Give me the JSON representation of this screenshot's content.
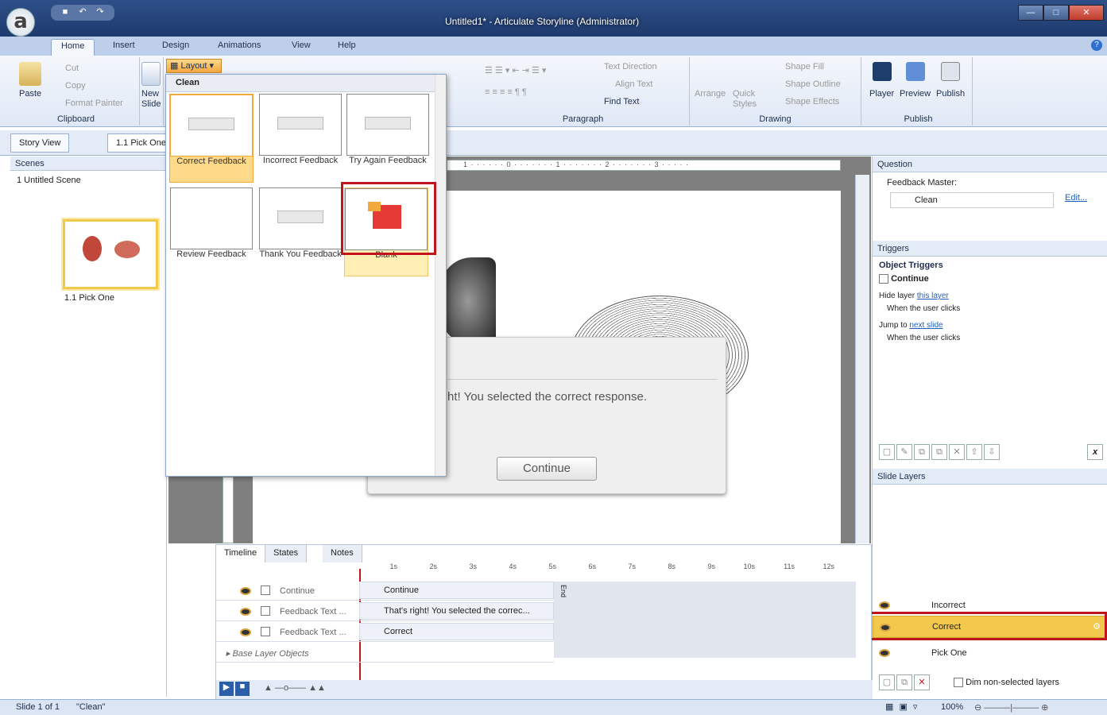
{
  "window": {
    "title": "Untitled1* - Articulate Storyline (Administrator)"
  },
  "menu_tabs": [
    "Home",
    "Insert",
    "Design",
    "Animations",
    "View",
    "Help"
  ],
  "ribbon": {
    "clipboard": {
      "paste": "Paste",
      "cut": "Cut",
      "copy": "Copy",
      "format_painter": "Format Painter",
      "label": "Clipboard"
    },
    "slides": {
      "new_slide": "New Slide",
      "layout": "Layout"
    },
    "paragraph": {
      "text_direction": "Text Direction",
      "align_text": "Align Text",
      "find_text": "Find Text",
      "label": "Paragraph"
    },
    "drawing": {
      "arrange": "Arrange",
      "quick_styles": "Quick Styles",
      "shape_fill": "Shape Fill",
      "shape_outline": "Shape Outline",
      "shape_effects": "Shape Effects",
      "label": "Drawing"
    },
    "publish": {
      "player": "Player",
      "preview": "Preview",
      "publish": "Publish",
      "label": "Publish"
    }
  },
  "subtabs": {
    "story_view": "Story View",
    "slide_tab": "1.1 Pick One"
  },
  "scenes": {
    "header": "Scenes",
    "scene_name": "1 Untitled Scene",
    "slide_label": "1.1 Pick One"
  },
  "layout_popup": {
    "header": "Clean",
    "items": [
      "Correct Feedback",
      "Incorrect Feedback",
      "Try Again Feedback",
      "Review Feedback",
      "Thank You Feedback",
      "Blank"
    ]
  },
  "slide": {
    "dialog_text": "ht!  You selected the correct response.",
    "dialog_button": "Continue",
    "ruler": "1 · · · · · · 0 · · · · · · · 1 · · · · · · · 2 · · · · · · · 3 · · · · ·"
  },
  "question_panel": {
    "header": "Question",
    "feedback_master_label": "Feedback Master:",
    "feedback_master_value": "Clean",
    "edit": "Edit..."
  },
  "triggers": {
    "header": "Triggers",
    "object_triggers": "Object Triggers",
    "object": "Continue",
    "t1_action": "Hide layer",
    "t1_link": "this layer",
    "t1_when": "When the user clicks",
    "t2_action": "Jump to",
    "t2_link": "next slide",
    "t2_when": "When the user clicks",
    "var_button": "x"
  },
  "slide_layers": {
    "header": "Slide Layers",
    "layers": [
      "Incorrect",
      "Correct",
      "Pick One"
    ],
    "dim_label": "Dim non-selected layers"
  },
  "timeline": {
    "tabs": [
      "Timeline",
      "States",
      "Notes"
    ],
    "ticks": [
      "1s",
      "2s",
      "3s",
      "4s",
      "5s",
      "6s",
      "7s",
      "8s",
      "9s",
      "10s",
      "11s",
      "12s"
    ],
    "rows": [
      {
        "name": "Continue",
        "bar": "Continue"
      },
      {
        "name": "Feedback Text ...",
        "bar": "That's right!  You selected the correc..."
      },
      {
        "name": "Feedback Text ...",
        "bar": "Correct"
      }
    ],
    "base_layer": "Base Layer Objects",
    "end_label": "End"
  },
  "status": {
    "slide_of": "Slide 1 of 1",
    "layout_name": "\"Clean\"",
    "zoom": "100%"
  }
}
